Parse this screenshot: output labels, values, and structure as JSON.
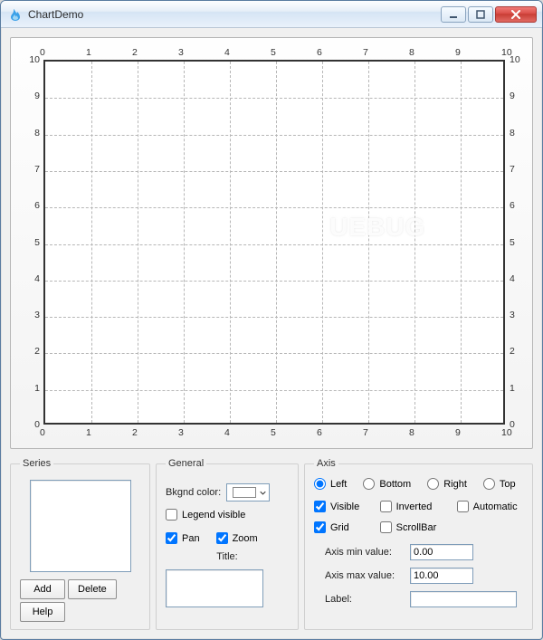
{
  "window": {
    "title": "ChartDemo"
  },
  "chart_data": {
    "type": "scatter",
    "x": [],
    "y": [],
    "title": "",
    "xlabel": "",
    "ylabel": "",
    "xlim": [
      0,
      10
    ],
    "ylim": [
      0,
      10
    ],
    "xticks": [
      0,
      1,
      2,
      3,
      4,
      5,
      6,
      7,
      8,
      9,
      10
    ],
    "yticks": [
      0,
      1,
      2,
      3,
      4,
      5,
      6,
      7,
      8,
      9,
      10
    ],
    "grid": true,
    "watermark": "UEBUG"
  },
  "groups": {
    "series": {
      "legend": "Series",
      "buttons": {
        "add": "Add",
        "delete": "Delete",
        "help": "Help"
      }
    },
    "general": {
      "legend": "General",
      "bkgnd_label": "Bkgnd color:",
      "legend_visible_label": "Legend visible",
      "legend_visible_checked": false,
      "pan_label": "Pan",
      "pan_checked": true,
      "zoom_label": "Zoom",
      "zoom_checked": true,
      "title_label": "Title:",
      "title_value": ""
    },
    "axis": {
      "legend": "Axis",
      "radios": {
        "left": "Left",
        "bottom": "Bottom",
        "right": "Right",
        "top": "Top",
        "selected": "left"
      },
      "checks": {
        "visible_label": "Visible",
        "visible": true,
        "inverted_label": "Inverted",
        "inverted": false,
        "automatic_label": "Automatic",
        "automatic": false,
        "grid_label": "Grid",
        "grid": true,
        "scrollbar_label": "ScrollBar",
        "scrollbar": false
      },
      "min_label": "Axis min value:",
      "min_value": "0.00",
      "max_label": "Axis max value:",
      "max_value": "10.00",
      "label_label": "Label:",
      "label_value": ""
    }
  }
}
